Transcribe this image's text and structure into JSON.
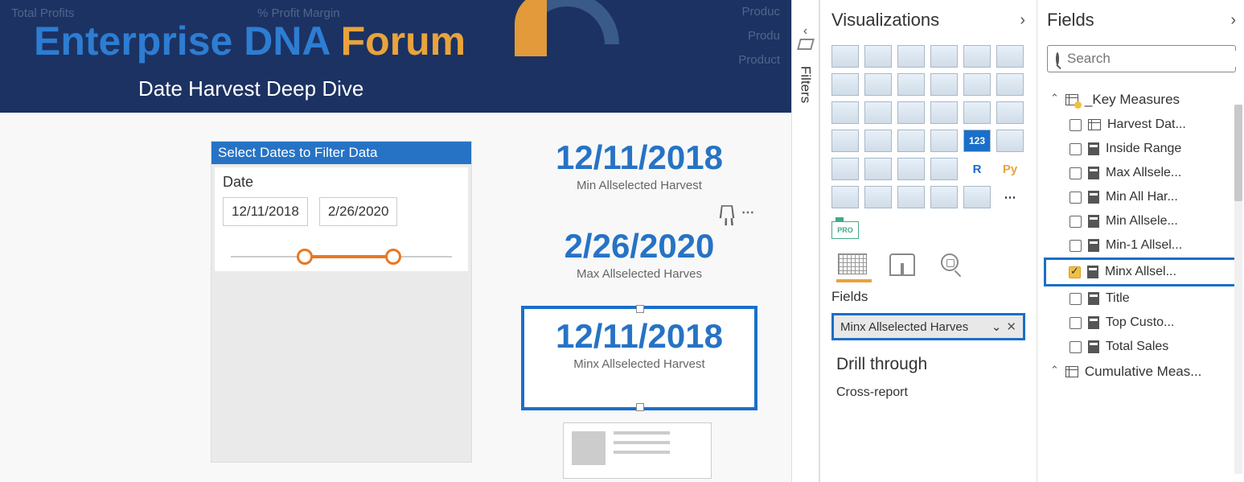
{
  "header": {
    "bg_labels": {
      "profits": "Total Profits",
      "margin": "% Profit Margin",
      "p1": "Produc",
      "p2": "Produ",
      "p3": "Product"
    },
    "title_a": "Enterprise DNA ",
    "title_b": "Forum",
    "subtitle": "Date Harvest Deep Dive"
  },
  "slicer": {
    "header": "Select Dates to Filter Data",
    "label": "Date",
    "from": "12/11/2018",
    "to": "2/26/2020"
  },
  "cards": {
    "c1": {
      "value": "12/11/2018",
      "label": "Min Allselected Harvest"
    },
    "c2": {
      "value": "2/26/2020",
      "label": "Max Allselected Harves"
    },
    "c3": {
      "value": "12/11/2018",
      "label": "Minx Allselected Harvest"
    }
  },
  "filters_strip": {
    "label": "Filters"
  },
  "viz": {
    "title": "Visualizations",
    "pro": "PRO",
    "r_label": "R",
    "py_label": "Py",
    "more": "⋯",
    "fields_label": "Fields",
    "field_well": "Minx Allselected Harves",
    "drill": "Drill through",
    "cross": "Cross-report"
  },
  "fields": {
    "title": "Fields",
    "search_placeholder": "Search",
    "group1": "_Key Measures",
    "items": [
      "Harvest Dat...",
      "Inside Range",
      "Max Allsele...",
      "Min All Har...",
      "Min Allsele...",
      "Min-1 Allsel...",
      "Minx Allsel...",
      "Title",
      "Top Custo...",
      "Total Sales"
    ],
    "group2": "Cumulative Meas..."
  }
}
